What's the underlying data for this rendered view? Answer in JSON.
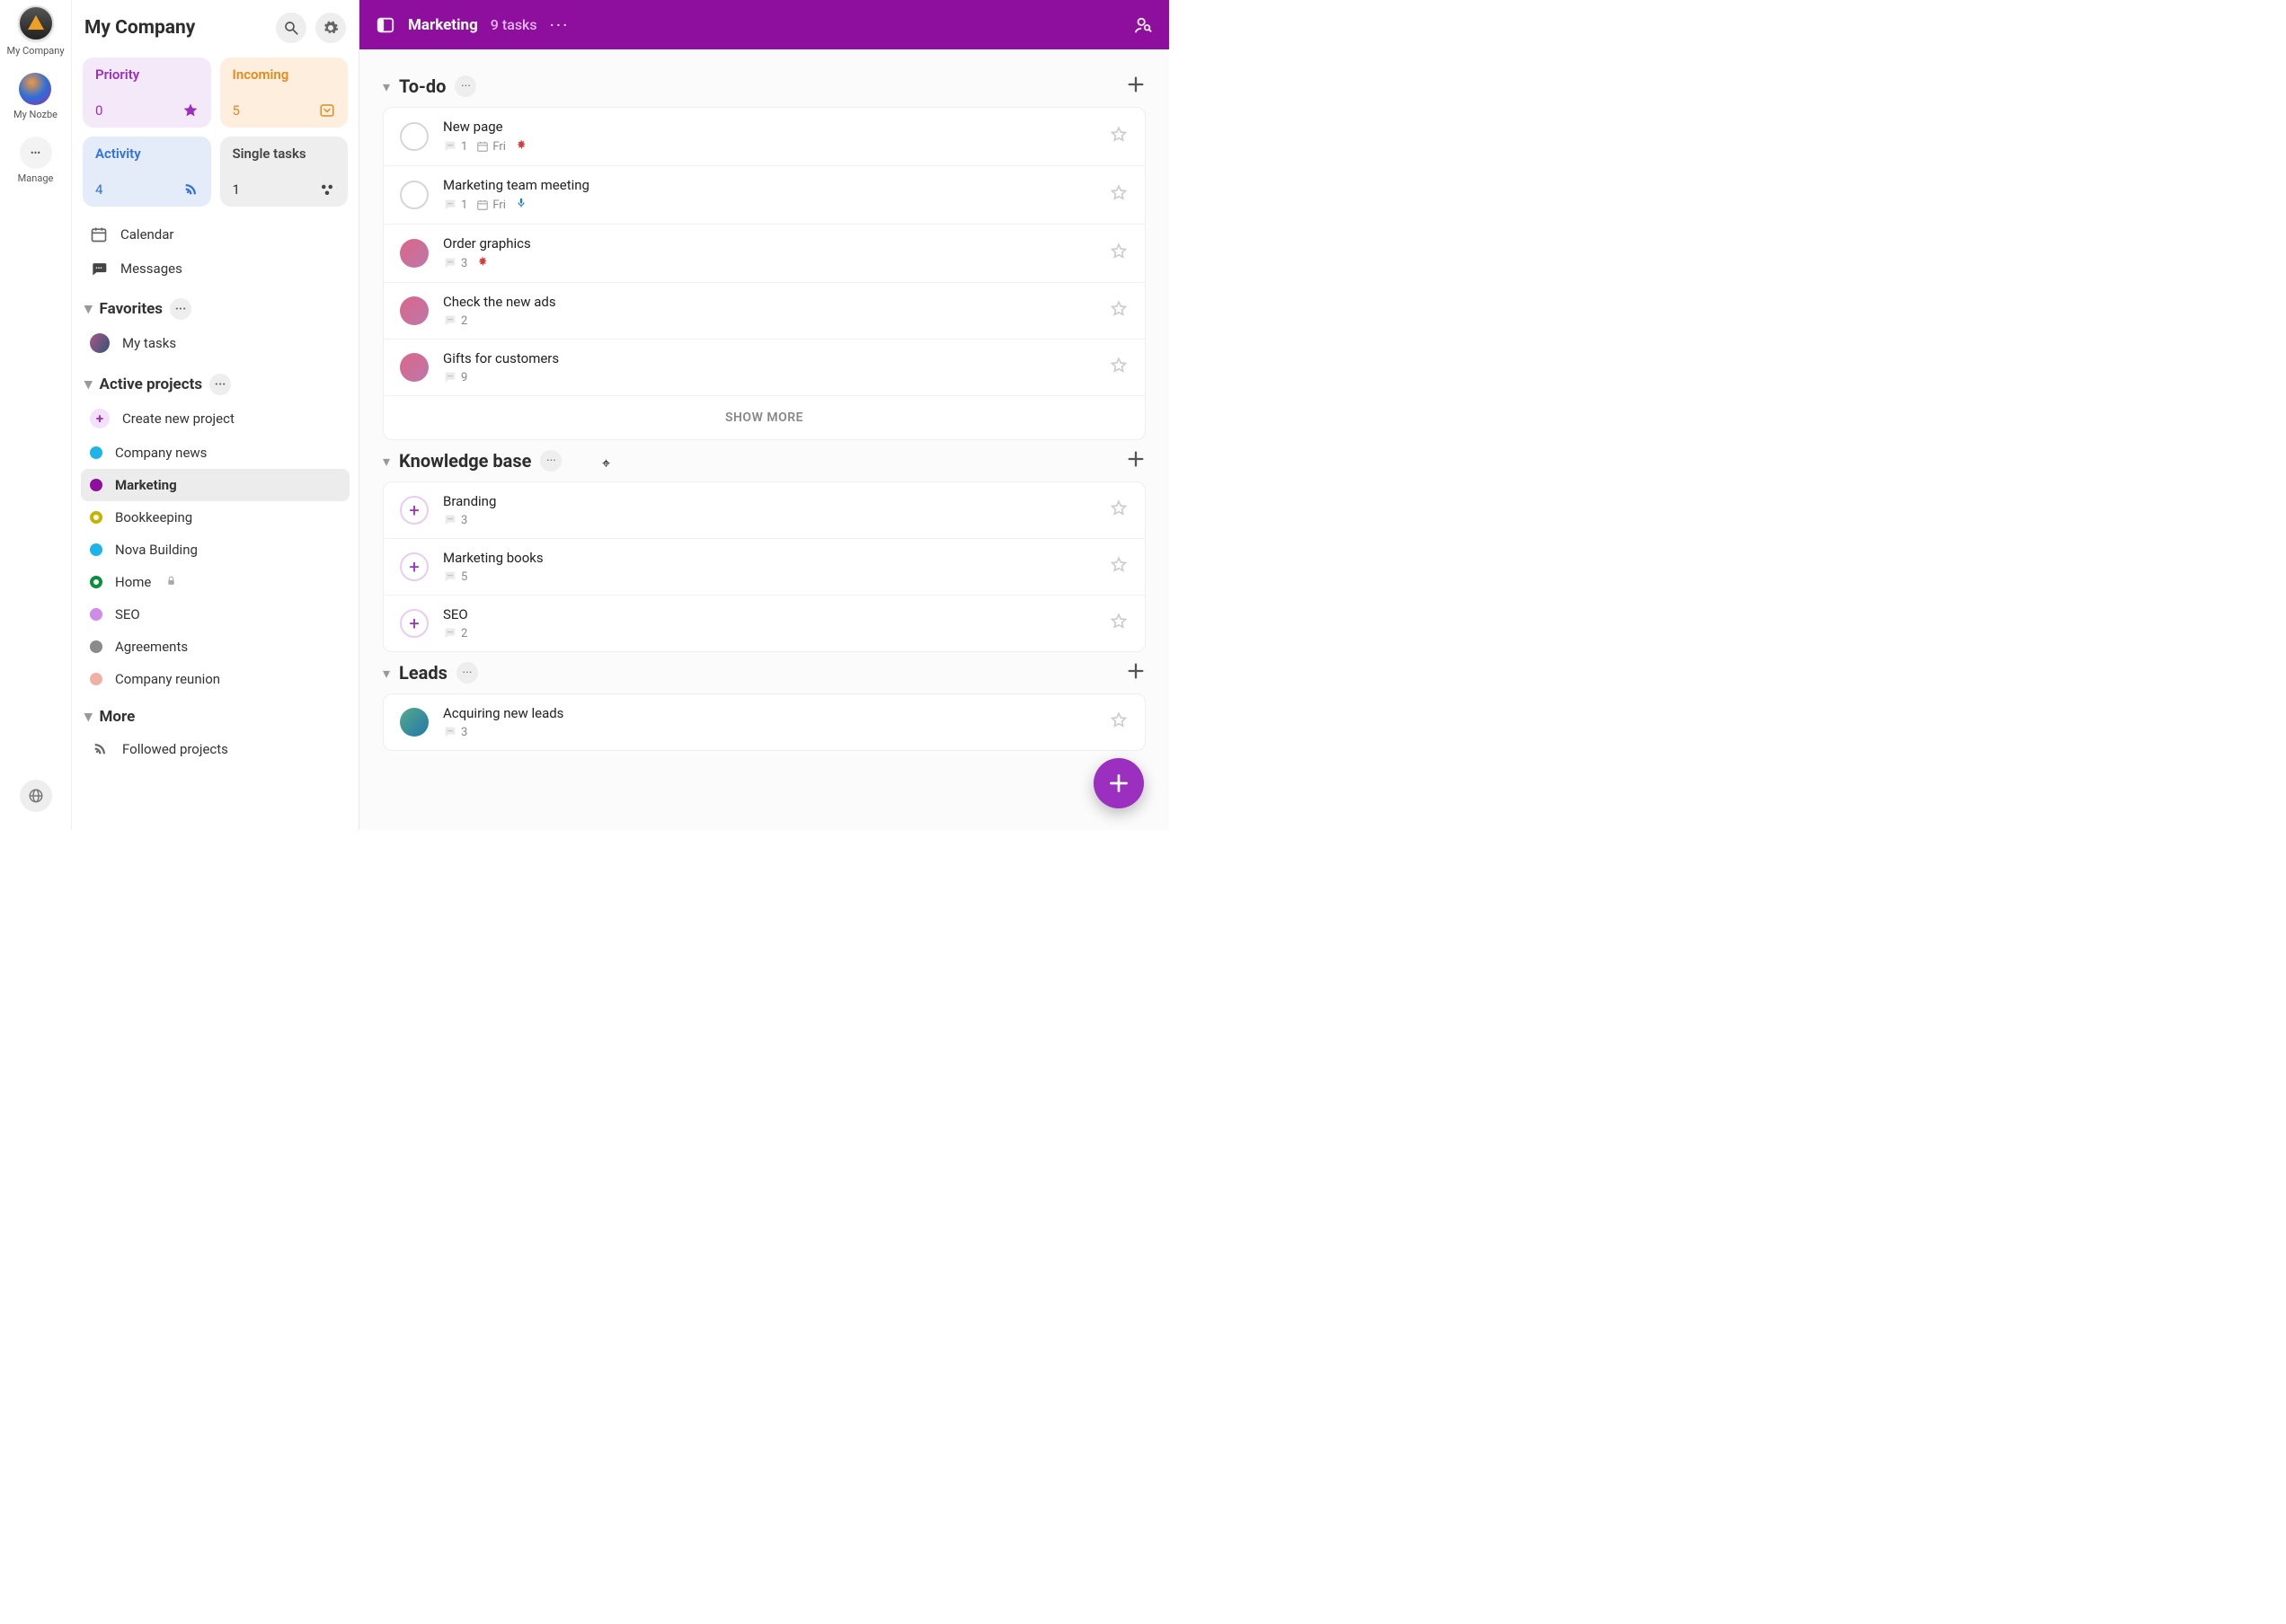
{
  "rail": {
    "company": "My Company",
    "nozbe": "My Nozbe",
    "manage": "Manage"
  },
  "sidebar": {
    "title": "My Company",
    "cards": {
      "priority": {
        "label": "Priority",
        "count": "0"
      },
      "incoming": {
        "label": "Incoming",
        "count": "5"
      },
      "activity": {
        "label": "Activity",
        "count": "4"
      },
      "single": {
        "label": "Single tasks",
        "count": "1"
      }
    },
    "calendar": "Calendar",
    "messages": "Messages",
    "favorites_header": "Favorites",
    "my_tasks": "My tasks",
    "active_header": "Active projects",
    "create_project": "Create new project",
    "projects": [
      {
        "label": "Company news",
        "color": "#1db4e8",
        "variant": "dot"
      },
      {
        "label": "Marketing",
        "color": "#8e0f9e",
        "variant": "dot",
        "active": true
      },
      {
        "label": "Bookkeeping",
        "color": "#c7b300",
        "variant": "ring"
      },
      {
        "label": "Nova Building",
        "color": "#1db4e8",
        "variant": "dot"
      },
      {
        "label": "Home",
        "color": "#0a8f3c",
        "variant": "ring",
        "locked": true
      },
      {
        "label": "SEO",
        "color": "#d08ae8",
        "variant": "dot"
      },
      {
        "label": "Agreements",
        "color": "#8a8a8a",
        "variant": "dot"
      },
      {
        "label": "Company reunion",
        "color": "#f1b0a5",
        "variant": "dot"
      }
    ],
    "more_header": "More",
    "followed": "Followed projects"
  },
  "topbar": {
    "title": "Marketing",
    "subtitle": "9 tasks"
  },
  "sections": [
    {
      "title": "To-do",
      "show_more": "SHOW MORE",
      "tasks": [
        {
          "title": "New page",
          "assignee": "none",
          "comments": "1",
          "date": "Fri",
          "flag": "red"
        },
        {
          "title": "Marketing team meeting",
          "assignee": "none",
          "comments": "1",
          "date": "Fri",
          "flag": "mic"
        },
        {
          "title": "Order graphics",
          "assignee": "avatar1",
          "comments": "3",
          "flag": "red"
        },
        {
          "title": "Check the new ads",
          "assignee": "avatar1",
          "comments": "2"
        },
        {
          "title": "Gifts for customers",
          "assignee": "avatar1",
          "comments": "9"
        }
      ]
    },
    {
      "title": "Knowledge base",
      "tasks": [
        {
          "title": "Branding",
          "assignee": "plus",
          "comments": "3"
        },
        {
          "title": "Marketing books",
          "assignee": "plus",
          "comments": "5"
        },
        {
          "title": "SEO",
          "assignee": "plus",
          "comments": "2"
        }
      ]
    },
    {
      "title": "Leads",
      "tasks": [
        {
          "title": "Acquiring new leads",
          "assignee": "avatar2",
          "comments": "3"
        }
      ]
    }
  ]
}
